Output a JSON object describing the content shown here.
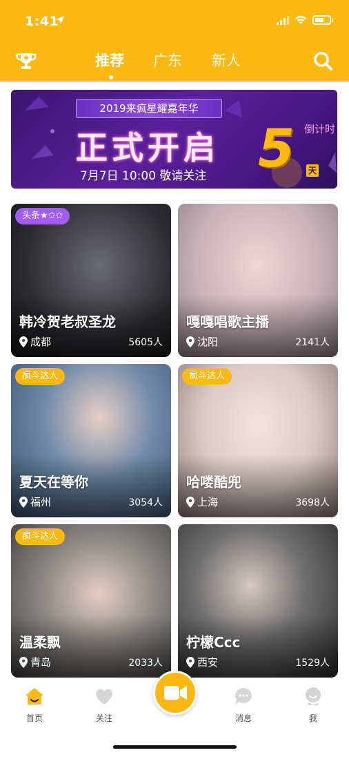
{
  "status_bar": {
    "time": "1:41"
  },
  "header": {
    "tabs": [
      {
        "label": "推荐",
        "active": true
      },
      {
        "label": "广东",
        "active": false
      },
      {
        "label": "新人",
        "active": false
      }
    ]
  },
  "banner": {
    "pill": "2019来疯星耀嘉年华",
    "title": "正式开启",
    "subtitle": "7月7日  10:00 敬请关注",
    "countdown_label": "倒计时",
    "countdown_value": "5",
    "countdown_unit": "天"
  },
  "cards": [
    {
      "name": "韩冷贺老叔圣龙",
      "city": "成都",
      "count": "5605人",
      "badge": "头条★✩✩",
      "badge_color": "#a45cf0",
      "bg": "#2b2b30"
    },
    {
      "name": "嘎嘎唱歌主播",
      "city": "沈阳",
      "count": "2141人",
      "badge": "",
      "badge_color": "",
      "bg": "#c9b2b8"
    },
    {
      "name": "夏天在等你",
      "city": "福州",
      "count": "3054人",
      "badge": "疯斗达人",
      "badge_color": "#FDB913",
      "bg": "#4a6a8a"
    },
    {
      "name": "哈喽酷兜",
      "city": "上海",
      "count": "3698人",
      "badge": "疯斗达人",
      "badge_color": "#FDB913",
      "bg": "#e8dede"
    },
    {
      "name": "温柔飘",
      "city": "青岛",
      "count": "2033人",
      "badge": "疯斗达人",
      "badge_color": "#FDB913",
      "bg": "#a8a6a2"
    },
    {
      "name": "柠檬Ccc",
      "city": "西安",
      "count": "1529人",
      "badge": "",
      "badge_color": "",
      "bg": "#5e5e5e"
    }
  ],
  "tabbar": {
    "home": "首页",
    "follow": "关注",
    "messages": "消息",
    "me": "我"
  },
  "colors": {
    "brand": "#FDB913",
    "banner_purple": "#5a1f9a"
  }
}
